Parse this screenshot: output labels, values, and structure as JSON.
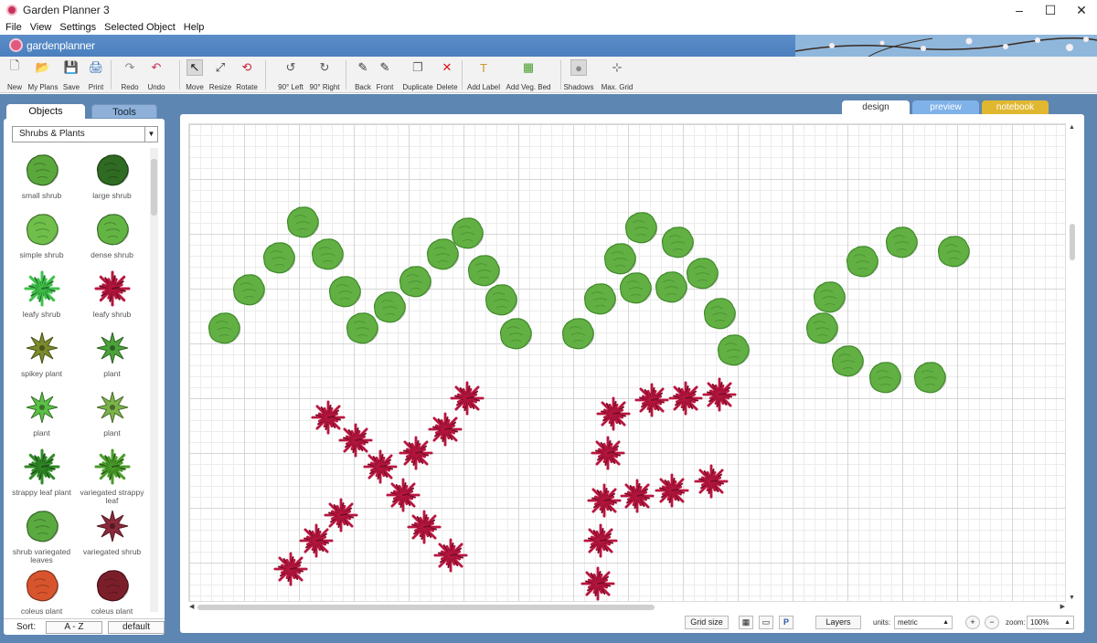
{
  "window": {
    "title": "Garden Planner 3",
    "controls": [
      "–",
      "☐",
      "✕"
    ]
  },
  "menu": [
    "File",
    "View",
    "Settings",
    "Selected Object",
    "Help"
  ],
  "brand": "gardenplanner",
  "toolbar": {
    "items": [
      {
        "label": "New",
        "icon": "new-file-icon",
        "glyph": "🗋"
      },
      {
        "label": "My Plans",
        "icon": "folder-icon",
        "glyph": "📂"
      },
      {
        "label": "Save",
        "icon": "save-icon",
        "glyph": "💾"
      },
      {
        "label": "Print",
        "icon": "print-icon",
        "glyph": "🖨"
      },
      {
        "label": "Redo",
        "icon": "redo-icon",
        "glyph": "↷"
      },
      {
        "label": "Undo",
        "icon": "undo-icon",
        "glyph": "↶"
      },
      {
        "label": "Move",
        "icon": "move-cursor-icon",
        "glyph": "↖"
      },
      {
        "label": "Resize",
        "icon": "resize-icon",
        "glyph": "⤢"
      },
      {
        "label": "Rotate",
        "icon": "rotate-icon",
        "glyph": "⟲"
      },
      {
        "label": "90° Left",
        "icon": "rotate-left-icon",
        "glyph": "↺"
      },
      {
        "label": "90° Right",
        "icon": "rotate-right-icon",
        "glyph": "↻"
      },
      {
        "label": "Back",
        "icon": "send-back-icon",
        "glyph": "✎"
      },
      {
        "label": "Front",
        "icon": "bring-front-icon",
        "glyph": "✎"
      },
      {
        "label": "Duplicate",
        "icon": "duplicate-icon",
        "glyph": "❐"
      },
      {
        "label": "Delete",
        "icon": "delete-icon",
        "glyph": "✕"
      },
      {
        "label": "Add Label",
        "icon": "text-label-icon",
        "glyph": "T"
      },
      {
        "label": "Add Veg. Bed",
        "icon": "veg-bed-icon",
        "glyph": "▦"
      },
      {
        "label": "Shadows",
        "icon": "shadows-icon",
        "glyph": "●"
      },
      {
        "label": "Max. Grid",
        "icon": "max-grid-icon",
        "glyph": "⊹"
      }
    ]
  },
  "left_panel": {
    "tabs": [
      "Objects",
      "Tools"
    ],
    "category": "Shrubs & Plants",
    "objects": [
      {
        "name": "small shrub",
        "kind": "round",
        "color": "#5aa83c"
      },
      {
        "name": "large shrub",
        "kind": "round",
        "color": "#2f6b22"
      },
      {
        "name": "simple shrub",
        "kind": "round",
        "color": "#6fbf4a"
      },
      {
        "name": "dense shrub",
        "kind": "round",
        "color": "#63b543"
      },
      {
        "name": "leafy shrub",
        "kind": "spiky",
        "color": "#3fc14a"
      },
      {
        "name": "leafy shrub",
        "kind": "spiky",
        "color": "#b8163f"
      },
      {
        "name": "spikey plant",
        "kind": "star",
        "color": "#7a8a2c"
      },
      {
        "name": "plant",
        "kind": "star",
        "color": "#4aa33a"
      },
      {
        "name": "plant",
        "kind": "star",
        "color": "#5bbf45"
      },
      {
        "name": "plant",
        "kind": "star",
        "color": "#7bb24a"
      },
      {
        "name": "strappy leaf plant",
        "kind": "spiky",
        "color": "#2f8a26"
      },
      {
        "name": "variegated strappy leaf",
        "kind": "spiky",
        "color": "#4a9e2a"
      },
      {
        "name": "shrub variegated leaves",
        "kind": "round",
        "color": "#5aaa40"
      },
      {
        "name": "variegated shrub",
        "kind": "star",
        "color": "#8a2a3a"
      },
      {
        "name": "coleus plant",
        "kind": "round",
        "color": "#d8542c"
      },
      {
        "name": "coleus plant",
        "kind": "round",
        "color": "#7a1f2a"
      }
    ],
    "sort_label": "Sort:",
    "sort_az": "A - Z",
    "sort_default": "default"
  },
  "view_tabs": [
    "design",
    "preview",
    "notebook"
  ],
  "status_bar": {
    "grid_size": "Grid size",
    "layers": "Layers",
    "units_label": "units:",
    "units_value": "metric",
    "zoom_label": "zoom:",
    "zoom_value": "100%"
  },
  "colors": {
    "shrub_green": "#62b043",
    "shrub_dark": "#3f8a2a",
    "plant_red": "#b8163f",
    "plant_dark": "#7a0c28",
    "workspace_bg": "#5e86b2"
  }
}
